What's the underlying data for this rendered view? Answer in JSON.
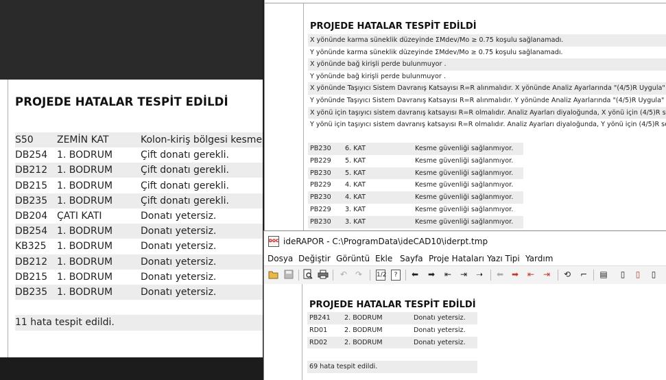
{
  "left_report": {
    "title": "PROJEDE HATALAR TESPİT EDİLDİ",
    "rows": [
      [
        "S50",
        "ZEMİN KAT",
        "Kolon-kiriş bölgesi kesme"
      ],
      [
        "DB254",
        "1. BODRUM",
        "Çift donatı gerekli."
      ],
      [
        "DB212",
        "1. BODRUM",
        "Çift donatı gerekli."
      ],
      [
        "DB215",
        "1. BODRUM",
        "Çift donatı gerekli."
      ],
      [
        "DB235",
        "1. BODRUM",
        "Çift donatı gerekli."
      ],
      [
        "DB204",
        "ÇATI KATI",
        "Donatı yetersiz."
      ],
      [
        "DB254",
        "1. BODRUM",
        "Donatı yetersiz."
      ],
      [
        "KB325",
        "1. BODRUM",
        "Donatı yetersiz."
      ],
      [
        "DB212",
        "1. BODRUM",
        "Donatı yetersiz."
      ],
      [
        "DB215",
        "1. BODRUM",
        "Donatı yetersiz."
      ],
      [
        "DB235",
        "1. BODRUM",
        "Donatı yetersiz."
      ]
    ],
    "summary": "11 hata tespit edildi."
  },
  "right_top_report": {
    "title": "PROJEDE HATALAR TESPİT EDİLDİ",
    "notes": [
      "X yönünde karma süneklik düzeyinde ΣMdev/Mo ≥ 0.75 koşulu sağlanamadı.",
      "Y yönünde karma süneklik düzeyinde ΣMdev/Mo ≥ 0.75 koşulu sağlanamadı.",
      " X yönünde bağ kirişli perde bulunmuyor .",
      " Y yönünde bağ kirişli perde bulunmuyor .",
      "X yönünde Taşıyıcı Sistem Davranış Katsayısı  R=R alınmalıdır. X yönünde Analiz Ayarlarında \"(4/5)R Uygula\"",
      "Y yönünde Taşıyıcı Sistem Davranış Katsayısı  R=R alınmalıdır. Y yönünde Analiz Ayarlarında \"(4/5)R Uygula\"",
      "X yönü için taşıyıcı sistem davranış katsayısı R=R olmalıdır. Analiz Ayarları diyaloğunda, X yönü için (4/5)R se",
      "Y yönü için taşıyıcı sistem davranış katsayısı R=R olmalıdır. Analiz Ayarları diyaloğunda, Y yönü için (4/5)R se"
    ],
    "rows": [
      [
        "PB230",
        "6. KAT",
        "Kesme güvenliği sağlanmıyor."
      ],
      [
        "PB229",
        "5. KAT",
        "Kesme güvenliği sağlanmıyor."
      ],
      [
        "PB230",
        "5. KAT",
        "Kesme güvenliği sağlanmıyor."
      ],
      [
        "PB229",
        "4. KAT",
        "Kesme güvenliği sağlanmıyor."
      ],
      [
        "PB230",
        "4. KAT",
        "Kesme güvenliği sağlanmıyor."
      ],
      [
        "PB229",
        "3. KAT",
        "Kesme güvenliği sağlanmıyor."
      ],
      [
        "PB230",
        "3. KAT",
        "Kesme güvenliği sağlanmıyor."
      ]
    ]
  },
  "app": {
    "icon_label": "DOC",
    "title": "ideRAPOR - C:\\ProgramData\\ideCAD10\\iderpt.tmp",
    "menu": [
      "Dosya",
      "Değiştir",
      "Görüntü",
      "Ekle",
      "Sayfa",
      "Proje Hataları",
      "Yazı Tipi",
      "Yardım"
    ],
    "toolbar": {
      "page_num_label": "1/2",
      "help_label": "?"
    }
  },
  "app_report": {
    "title": "PROJEDE HATALAR TESPİT EDİLDİ",
    "rows": [
      [
        "PB241",
        "2. BODRUM",
        "Donatı yetersiz."
      ],
      [
        "RD01",
        "2. BODRUM",
        "Donatı yetersiz."
      ],
      [
        "RD02",
        "2. BODRUM",
        "Donatı yetersiz."
      ]
    ],
    "summary": "69 hata tespit edildi."
  }
}
